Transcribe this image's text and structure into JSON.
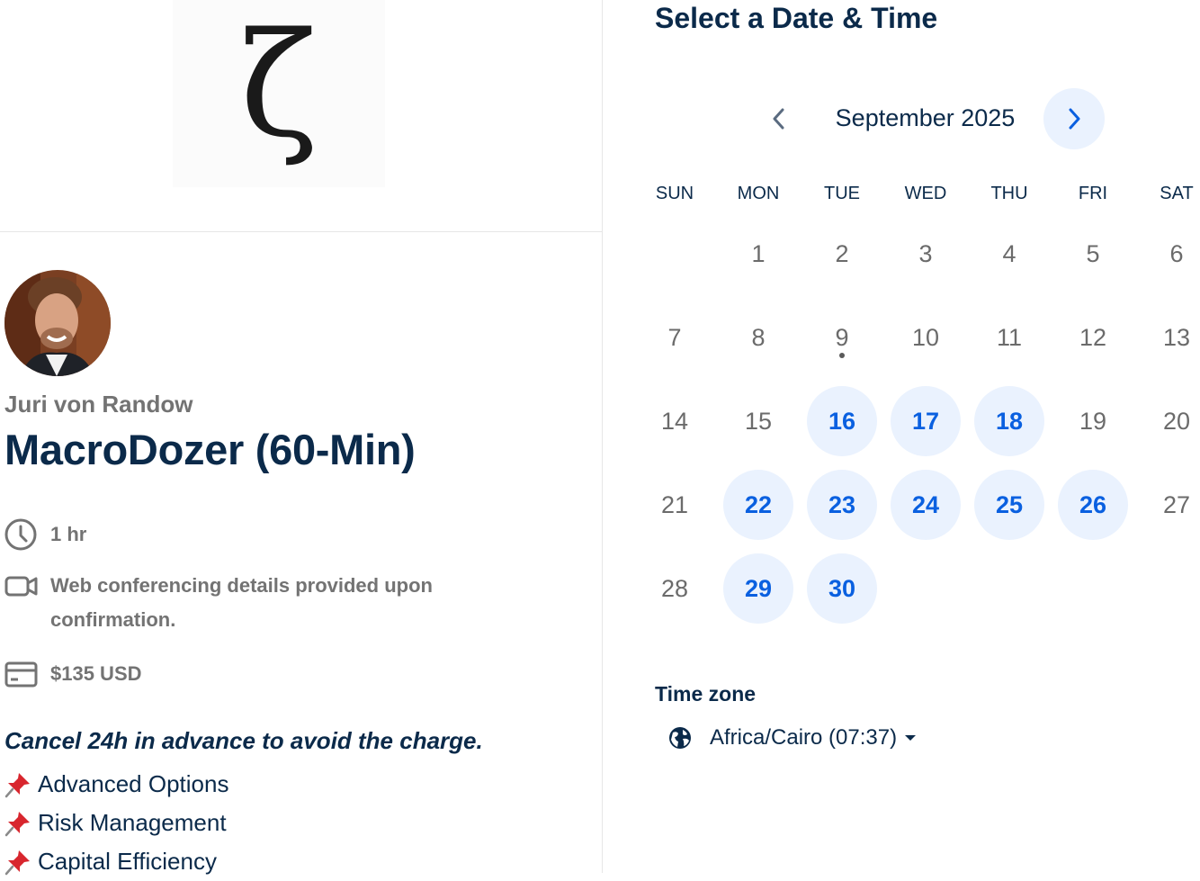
{
  "brand": {
    "logo_glyph": "ζ"
  },
  "host": {
    "name": "Juri von Randow"
  },
  "event": {
    "title": "MacroDozer (60-Min)",
    "duration": "1 hr",
    "location": "Web conferencing details provided upon confirmation.",
    "price": "$135 USD",
    "cancel_note": "Cancel 24h in advance to avoid the charge.",
    "features": [
      "Advanced Options",
      "Risk Management",
      "Capital Efficiency"
    ]
  },
  "scheduler": {
    "title": "Select a Date & Time",
    "month_label": "September 2025",
    "weekdays": [
      "SUN",
      "MON",
      "TUE",
      "WED",
      "THU",
      "FRI",
      "SAT"
    ],
    "first_weekday_index": 1,
    "days_in_month": 30,
    "today": 9,
    "available_days": [
      16,
      17,
      18,
      22,
      23,
      24,
      25,
      26,
      29,
      30
    ],
    "timezone_label": "Time zone",
    "timezone_value": "Africa/Cairo (07:37)"
  },
  "colors": {
    "accent": "#0a60e0",
    "available_bg": "#eaf2fe",
    "heading": "#0b2a4a",
    "muted": "#737373"
  }
}
